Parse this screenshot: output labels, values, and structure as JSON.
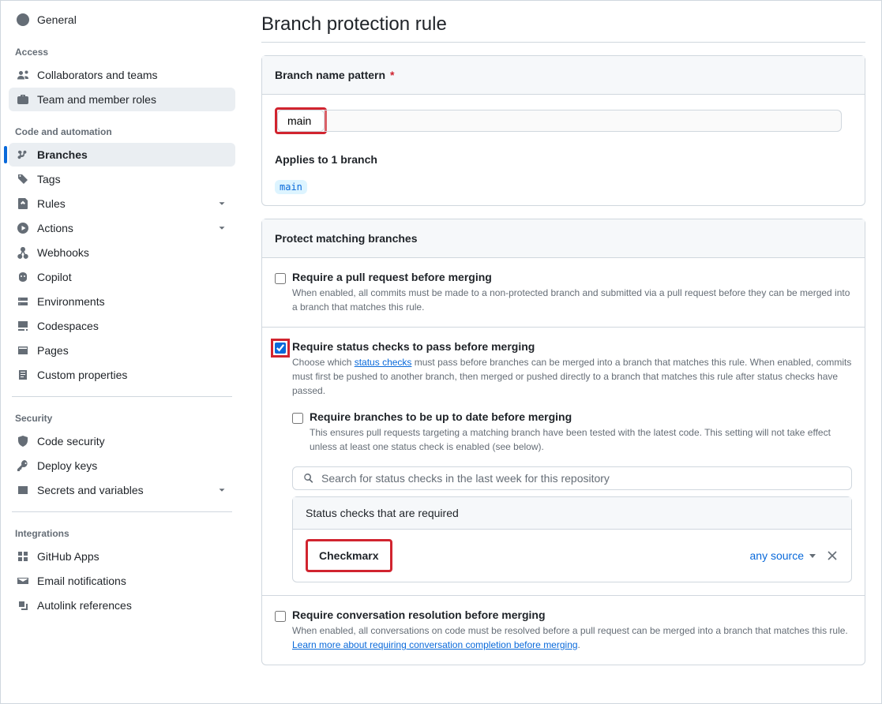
{
  "sidebar": {
    "top_item": "General",
    "groups": {
      "access": {
        "label": "Access",
        "items": [
          {
            "label": "Collaborators and teams"
          },
          {
            "label": "Team and member roles"
          }
        ]
      },
      "code": {
        "label": "Code and automation",
        "items": [
          {
            "label": "Branches"
          },
          {
            "label": "Tags"
          },
          {
            "label": "Rules"
          },
          {
            "label": "Actions"
          },
          {
            "label": "Webhooks"
          },
          {
            "label": "Copilot"
          },
          {
            "label": "Environments"
          },
          {
            "label": "Codespaces"
          },
          {
            "label": "Pages"
          },
          {
            "label": "Custom properties"
          }
        ]
      },
      "security": {
        "label": "Security",
        "items": [
          {
            "label": "Code security"
          },
          {
            "label": "Deploy keys"
          },
          {
            "label": "Secrets and variables"
          }
        ]
      },
      "integrations": {
        "label": "Integrations",
        "items": [
          {
            "label": "GitHub Apps"
          },
          {
            "label": "Email notifications"
          },
          {
            "label": "Autolink references"
          }
        ]
      }
    }
  },
  "main": {
    "title": "Branch protection rule",
    "pattern": {
      "label": "Branch name pattern",
      "required": "*",
      "value": "main",
      "applies": "Applies to 1 branch",
      "branch_tag": "main"
    },
    "protect_header": "Protect matching branches",
    "rules": {
      "pr": {
        "title": "Require a pull request before merging",
        "desc": "When enabled, all commits must be made to a non-protected branch and submitted via a pull request before they can be merged into a branch that matches this rule."
      },
      "status": {
        "title": "Require status checks to pass before merging",
        "desc_pre": "Choose which ",
        "desc_link": "status checks",
        "desc_post": " must pass before branches can be merged into a branch that matches this rule. When enabled, commits must first be pushed to another branch, then merged or pushed directly to a branch that matches this rule after status checks have passed.",
        "uptodate": {
          "title": "Require branches to be up to date before merging",
          "desc": "This ensures pull requests targeting a matching branch have been tested with the latest code. This setting will not take effect unless at least one status check is enabled (see below)."
        },
        "search_placeholder": "Search for status checks in the last week for this repository",
        "required_header": "Status checks that are required",
        "check_name": "Checkmarx",
        "source_label": "any source"
      },
      "convo": {
        "title": "Require conversation resolution before merging",
        "desc": "When enabled, all conversations on code must be resolved before a pull request can be merged into a branch that matches this rule. ",
        "link": "Learn more about requiring conversation completion before merging"
      }
    }
  }
}
